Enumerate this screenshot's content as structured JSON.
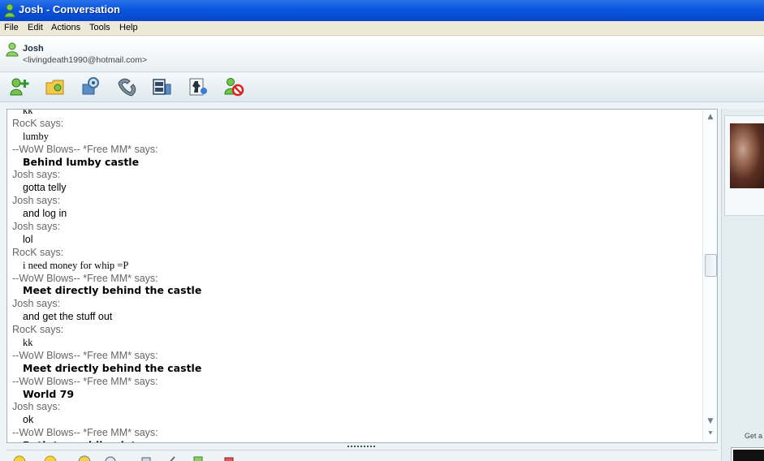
{
  "window": {
    "title": "Josh - Conversation"
  },
  "menu": [
    "File",
    "Edit",
    "Actions",
    "Tools",
    "Help"
  ],
  "contact": {
    "name": "Josh",
    "email": "<livingdeath1990@hotmail.com>"
  },
  "toolbar": {
    "buttons": [
      {
        "name": "invite-contact-icon"
      },
      {
        "name": "send-files-icon"
      },
      {
        "name": "webcam-icon"
      },
      {
        "name": "call-icon"
      },
      {
        "name": "activities-icon"
      },
      {
        "name": "games-icon"
      },
      {
        "name": "block-icon"
      }
    ]
  },
  "conversation": {
    "lines": [
      {
        "kind": "msg",
        "who": "rock",
        "text": "kk"
      },
      {
        "kind": "sender",
        "text": "RocK says:"
      },
      {
        "kind": "msg",
        "who": "rock",
        "text": "lumby"
      },
      {
        "kind": "sender",
        "text": "--WoW Blows-- *Free MM* says:"
      },
      {
        "kind": "msg",
        "who": "wow",
        "text": "Behind lumby castle"
      },
      {
        "kind": "sender",
        "text": "Josh says:"
      },
      {
        "kind": "msg",
        "who": "josh",
        "text": "gotta telly"
      },
      {
        "kind": "sender",
        "text": "Josh says:"
      },
      {
        "kind": "msg",
        "who": "josh",
        "text": "and log in"
      },
      {
        "kind": "sender",
        "text": "Josh says:"
      },
      {
        "kind": "msg",
        "who": "josh",
        "text": "lol"
      },
      {
        "kind": "sender",
        "text": "RocK says:"
      },
      {
        "kind": "msg",
        "who": "rock",
        "text": "i need money for whip =P"
      },
      {
        "kind": "sender",
        "text": "--WoW Blows-- *Free MM* says:"
      },
      {
        "kind": "msg",
        "who": "wow",
        "text": "Meet directly behind the castle"
      },
      {
        "kind": "sender",
        "text": "Josh says:"
      },
      {
        "kind": "msg",
        "who": "josh",
        "text": "and get the stuff out"
      },
      {
        "kind": "sender",
        "text": "RocK says:"
      },
      {
        "kind": "msg",
        "who": "rock",
        "text": "kk"
      },
      {
        "kind": "sender",
        "text": "--WoW Blows-- *Free MM* says:"
      },
      {
        "kind": "msg",
        "who": "wow",
        "text": "Meet driectly behind the castle"
      },
      {
        "kind": "sender",
        "text": "--WoW Blows-- *Free MM* says:"
      },
      {
        "kind": "msg",
        "who": "wow",
        "text": "World 79"
      },
      {
        "kind": "sender",
        "text": "Josh says:"
      },
      {
        "kind": "msg",
        "who": "josh",
        "text": "ok"
      },
      {
        "kind": "sender",
        "text": "--WoW Blows-- *Free MM* says:"
      },
      {
        "kind": "msg",
        "who": "wow",
        "text": "Both to weddin plat"
      }
    ]
  },
  "bottombar": {
    "icons": [
      "emoticon-icon",
      "wink-icon",
      "nudge-icon",
      "voice-clip-icon",
      "font-icon",
      "background-icon",
      "handwriting-icon",
      "gift-icon"
    ]
  },
  "rightpanel": {
    "ad_text": "Get a"
  },
  "colors": {
    "title_bar": "#0a55e0",
    "sender_text": "#666666",
    "message_text": "#000000"
  }
}
